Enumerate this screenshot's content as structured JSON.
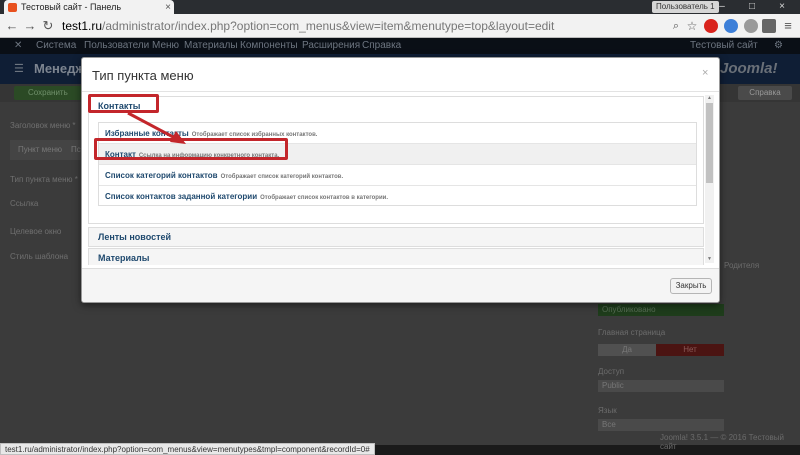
{
  "browser": {
    "tab_title": "Тестовый сайт - Панель",
    "user_badge": "Пользователь 1",
    "url_host": "test1.ru",
    "url_path": "/administrator/index.php?option=com_menus&view=item&menutype=top&layout=edit",
    "status_url": "test1.ru/administrator/index.php?option=com_menus&view=menutypes&tmpl=component&recordId=0#"
  },
  "admin": {
    "topnav": [
      "Система",
      "Пользователи",
      "Меню",
      "Материалы",
      "Компоненты",
      "Расширения",
      "Справка"
    ],
    "site_link": "Тестовый сайт",
    "header_title": "Менедж",
    "logo": "Joomla!",
    "save_label": "Сохранить",
    "help_label": "Справка",
    "left_labels": [
      "Заголовок меню *",
      "Тип пункта меню *",
      "Ссылка",
      "Целевое окно",
      "Стиль шаблона"
    ],
    "tab_label": "Пункт меню",
    "tab_label2": "Пс",
    "right_labels": {
      "cut": "Родителя",
      "home": "Главная страница",
      "access": "Доступ",
      "language": "Язык"
    },
    "published": "Опубликовано",
    "yes": "Да",
    "no": "Нет",
    "access_value": "Public",
    "language_value": "Все",
    "footer": "Joomla! 3.5.1 — © 2016 Тестовый сайт"
  },
  "modal": {
    "title": "Тип пункта меню",
    "close_glyph": "×",
    "groups": [
      {
        "label": "Контакты",
        "items": [
          {
            "name": "Избранные контакты",
            "desc": "Отображает список избранных контактов."
          },
          {
            "name": "Контакт",
            "desc": "Ссылка на информацию конкретного контакта."
          },
          {
            "name": "Список категорий контактов",
            "desc": "Отображает список категорий контактов."
          },
          {
            "name": "Список контактов заданной категории",
            "desc": "Отображает список контактов в категории."
          }
        ]
      },
      {
        "label": "Ленты новостей"
      },
      {
        "label": "Материалы"
      }
    ],
    "close_button": "Закрыть"
  },
  "colors": {
    "highlight": "#c3262b",
    "link": "#1f496e",
    "published": "#1e3c1b",
    "no_active": "#4b1412"
  },
  "icons": [
    "back-arrow-icon",
    "forward-arrow-icon",
    "reload-icon",
    "search-icon",
    "star-icon",
    "adblock-icon",
    "settings-icon",
    "close-icon",
    "joomla-logo-icon"
  ]
}
